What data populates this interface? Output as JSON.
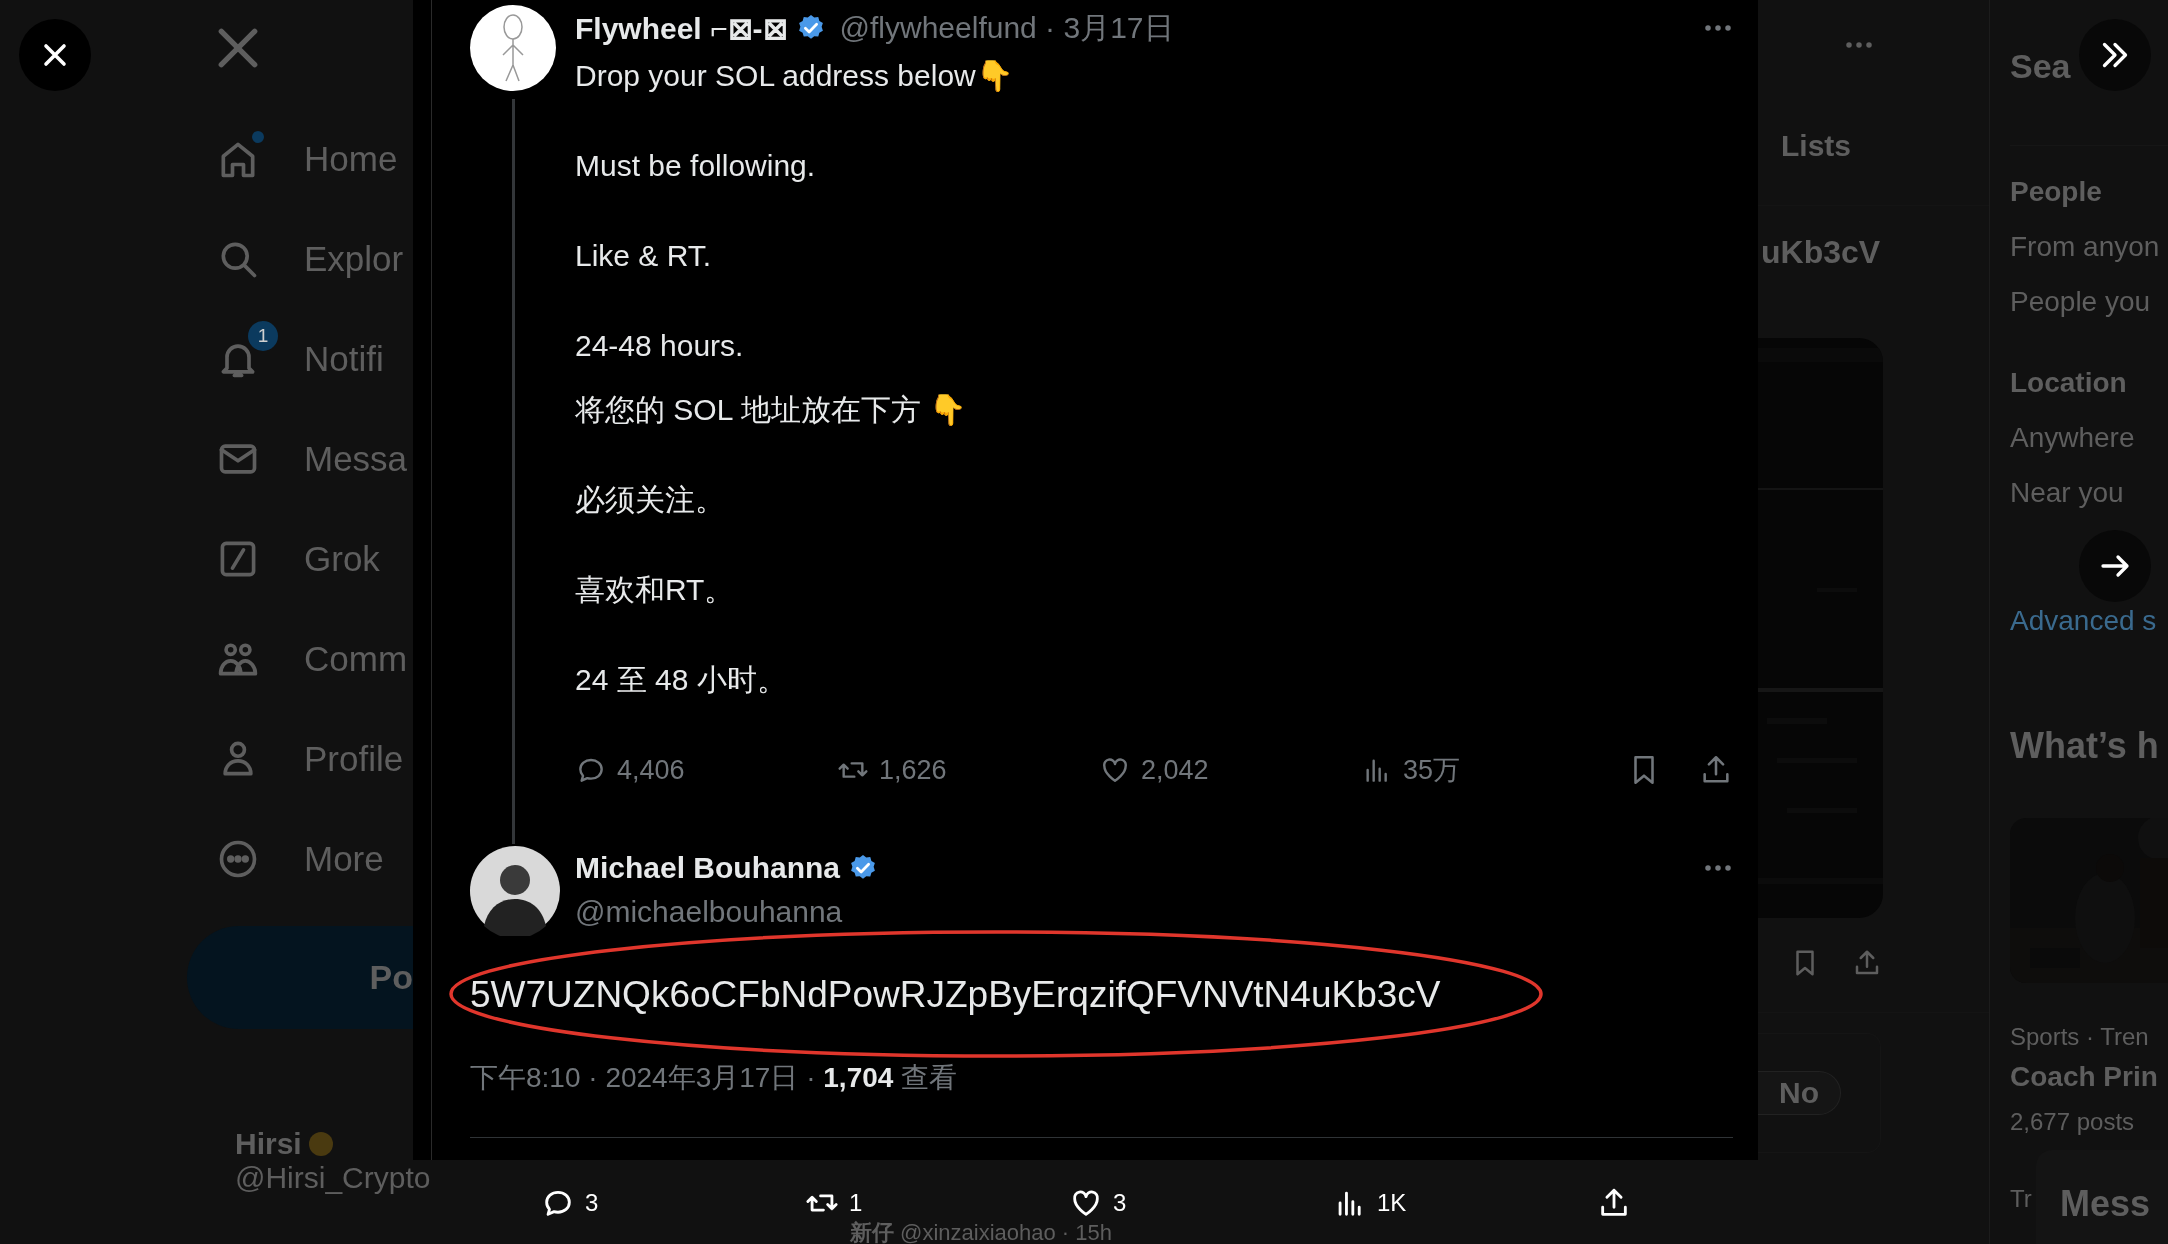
{
  "sidebar": {
    "items": [
      {
        "label": "Home",
        "unread": true
      },
      {
        "label": "Explor",
        "unread": false
      },
      {
        "label": "Notifi",
        "unread": false,
        "badge": "1"
      },
      {
        "label": "Messa",
        "unread": false
      },
      {
        "label": "Grok",
        "unread": false
      },
      {
        "label": "Comm",
        "unread": false
      },
      {
        "label": "Profile",
        "unread": false
      },
      {
        "label": "More",
        "unread": false
      }
    ],
    "post_button": "Po",
    "account": {
      "name": "Hirsi",
      "handle": "@Hirsi_Crypto"
    }
  },
  "timeline": {
    "tabs": [
      {
        "label": "Lists"
      }
    ],
    "post_fragment": "uKb3cV",
    "poll_option": "No",
    "reply_preview": "**新仔** @xinzaixiaohao · 15h"
  },
  "tweet": {
    "author": "Flywheel ⌐⊠-⊠",
    "verified": true,
    "meta": "@flywheelfund · 3月17日",
    "text": [
      {
        "text": "Drop your SOL address below👇"
      },
      {
        "text": "Must be following."
      },
      {
        "text": "Like & RT."
      },
      {
        "text": "24-48 hours."
      }
    ],
    "translation": [
      {
        "text": "将您的 SOL 地址放在下方 👇"
      },
      {
        "text": "必须关注。"
      },
      {
        "text": "喜欢和RT。"
      },
      {
        "text": "24 至 48 小时。"
      }
    ],
    "stats": {
      "replies": "4,406",
      "reposts": "1,626",
      "likes": "2,042",
      "views": "35万"
    }
  },
  "reply": {
    "author": "Michael Bouhanna",
    "verified": true,
    "handle": "@michaelbouhanna",
    "text": "5W7UZNQk6oCFbNdPowRJZpByErqzifQFVNVtN4uKb3cV",
    "meta": "下午8:10 · 2024年3月17日 · **1,704** 查看",
    "highlighted": true
  },
  "media_bar": [
    {
      "kind": "reply",
      "count": "3"
    },
    {
      "kind": "repost",
      "count": "1"
    },
    {
      "kind": "like",
      "count": "3"
    },
    {
      "kind": "views",
      "count": "1K"
    },
    {
      "kind": "share"
    }
  ],
  "search_filters": {
    "title": "Sea",
    "sections": [
      {
        "heading": "People",
        "options": [
          "From anyon",
          "People you"
        ]
      },
      {
        "heading": "Location",
        "options": [
          "Anywhere",
          "Near you"
        ]
      }
    ],
    "advanced_link": "Advanced s"
  },
  "trends": {
    "title": "What’s h",
    "items": [
      {
        "context": "Sports · Tren",
        "name": "Coach Prin",
        "count": "2,677 posts"
      },
      {
        "context": "Tr"
      }
    ]
  },
  "messages_drawer": {
    "title": "Mess"
  }
}
